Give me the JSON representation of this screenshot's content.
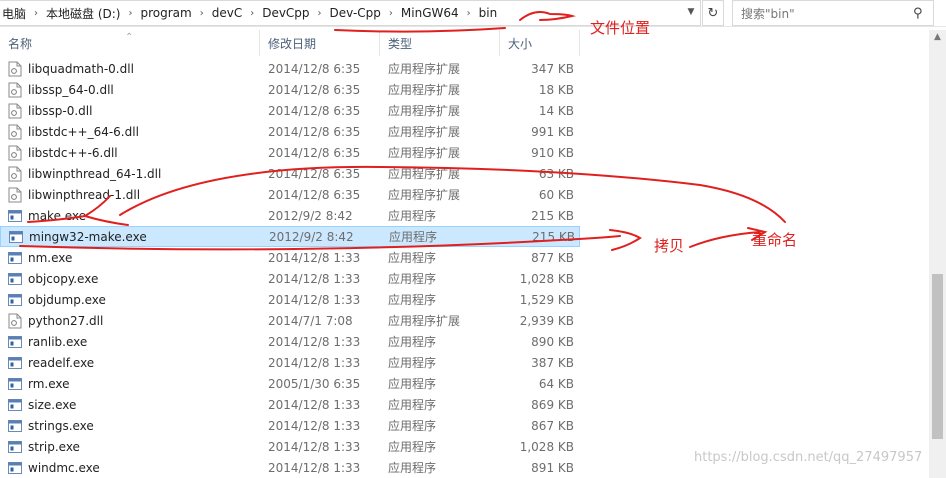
{
  "address": {
    "crumbs": [
      "电脑",
      "本地磁盘 (D:)",
      "program",
      "devC",
      "DevCpp",
      "Dev-Cpp",
      "MinGW64",
      "bin"
    ]
  },
  "search": {
    "placeholder": "搜索\"bin\""
  },
  "columns": {
    "name": "名称",
    "date": "修改日期",
    "type": "类型",
    "size": "大小"
  },
  "files": [
    {
      "name": "libquadmath-0.dll",
      "date": "2014/12/8 6:35",
      "type": "应用程序扩展",
      "size": "347 KB",
      "kind": "dll"
    },
    {
      "name": "libssp_64-0.dll",
      "date": "2014/12/8 6:35",
      "type": "应用程序扩展",
      "size": "18 KB",
      "kind": "dll"
    },
    {
      "name": "libssp-0.dll",
      "date": "2014/12/8 6:35",
      "type": "应用程序扩展",
      "size": "14 KB",
      "kind": "dll"
    },
    {
      "name": "libstdc++_64-6.dll",
      "date": "2014/12/8 6:35",
      "type": "应用程序扩展",
      "size": "991 KB",
      "kind": "dll"
    },
    {
      "name": "libstdc++-6.dll",
      "date": "2014/12/8 6:35",
      "type": "应用程序扩展",
      "size": "910 KB",
      "kind": "dll"
    },
    {
      "name": "libwinpthread_64-1.dll",
      "date": "2014/12/8 6:35",
      "type": "应用程序扩展",
      "size": "63 KB",
      "kind": "dll"
    },
    {
      "name": "libwinpthread-1.dll",
      "date": "2014/12/8 6:35",
      "type": "应用程序扩展",
      "size": "60 KB",
      "kind": "dll"
    },
    {
      "name": "make.exe",
      "date": "2012/9/2 8:42",
      "type": "应用程序",
      "size": "215 KB",
      "kind": "exe"
    },
    {
      "name": "mingw32-make.exe",
      "date": "2012/9/2 8:42",
      "type": "应用程序",
      "size": "215 KB",
      "kind": "exe",
      "selected": true
    },
    {
      "name": "nm.exe",
      "date": "2014/12/8 1:33",
      "type": "应用程序",
      "size": "877 KB",
      "kind": "exe"
    },
    {
      "name": "objcopy.exe",
      "date": "2014/12/8 1:33",
      "type": "应用程序",
      "size": "1,028 KB",
      "kind": "exe"
    },
    {
      "name": "objdump.exe",
      "date": "2014/12/8 1:33",
      "type": "应用程序",
      "size": "1,529 KB",
      "kind": "exe"
    },
    {
      "name": "python27.dll",
      "date": "2014/7/1 7:08",
      "type": "应用程序扩展",
      "size": "2,939 KB",
      "kind": "dll"
    },
    {
      "name": "ranlib.exe",
      "date": "2014/12/8 1:33",
      "type": "应用程序",
      "size": "890 KB",
      "kind": "exe"
    },
    {
      "name": "readelf.exe",
      "date": "2014/12/8 1:33",
      "type": "应用程序",
      "size": "387 KB",
      "kind": "exe"
    },
    {
      "name": "rm.exe",
      "date": "2005/1/30 6:35",
      "type": "应用程序",
      "size": "64 KB",
      "kind": "exe"
    },
    {
      "name": "size.exe",
      "date": "2014/12/8 1:33",
      "type": "应用程序",
      "size": "869 KB",
      "kind": "exe"
    },
    {
      "name": "strings.exe",
      "date": "2014/12/8 1:33",
      "type": "应用程序",
      "size": "867 KB",
      "kind": "exe"
    },
    {
      "name": "strip.exe",
      "date": "2014/12/8 1:33",
      "type": "应用程序",
      "size": "1,028 KB",
      "kind": "exe"
    },
    {
      "name": "windmc.exe",
      "date": "2014/12/8 1:33",
      "type": "应用程序",
      "size": "891 KB",
      "kind": "exe"
    }
  ],
  "annotations": {
    "location": "文件位置",
    "copy": "拷贝",
    "rename": "重命名"
  },
  "watermark": "https://blog.csdn.net/qq_27497957",
  "colors": {
    "annotation": "#e0201e",
    "selection": "#cce8ff",
    "header": "#4c607a"
  }
}
